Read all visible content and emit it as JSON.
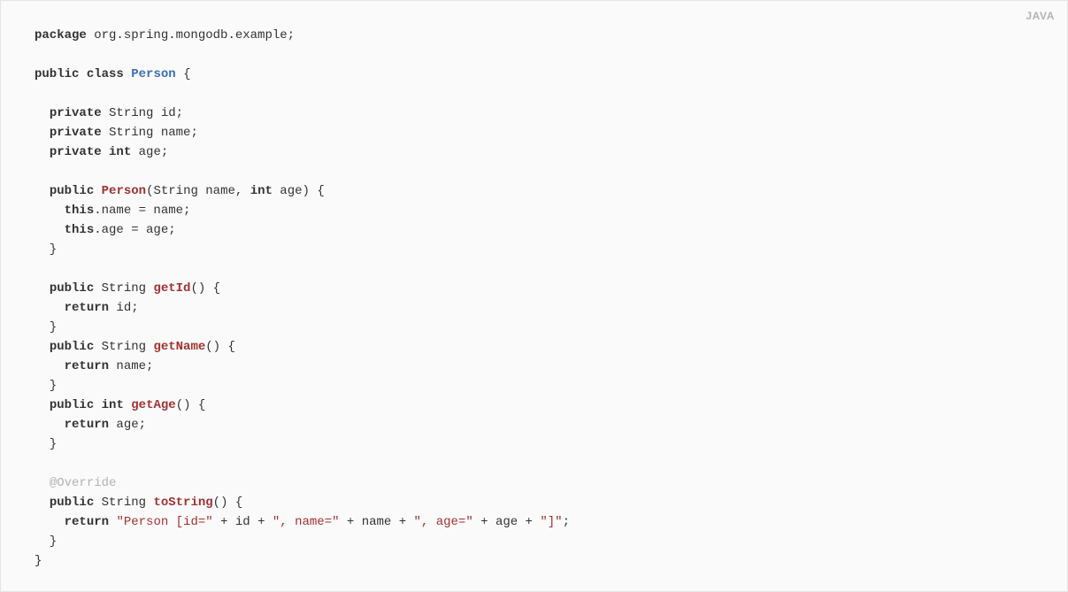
{
  "lang_label": "JAVA",
  "code": {
    "kw_package": "package",
    "pkg_name": " org.spring.mongodb.example;",
    "kw_public1": "public",
    "kw_class": "class",
    "class_name": "Person",
    "brace_open": " {",
    "kw_private1": "private",
    "field_id": " String id;",
    "kw_private2": "private",
    "field_name": " String name;",
    "kw_private3": "private",
    "kw_int1": "int",
    "field_age": " age;",
    "kw_public2": "public",
    "ctor_name": "Person",
    "ctor_sig_open": "(String name, ",
    "kw_int2": "int",
    "ctor_sig_close": " age) {",
    "kw_this1": "this",
    "assign_name": ".name = name;",
    "kw_this2": "this",
    "assign_age": ".age = age;",
    "brace_close1": "  }",
    "kw_public3": "public",
    "ret_str1": " String ",
    "fn_getId": "getId",
    "paren_brace1": "() {",
    "kw_return1": "return",
    "ret_id": " id;",
    "brace_close2": "  }",
    "kw_public4": "public",
    "ret_str2": " String ",
    "fn_getName": "getName",
    "paren_brace2": "() {",
    "kw_return2": "return",
    "ret_name": " name;",
    "brace_close3": "  }",
    "kw_public5": "public",
    "kw_int3": "int",
    "fn_getAge": "getAge",
    "paren_brace3": "() {",
    "kw_return3": "return",
    "ret_age": " age;",
    "brace_close4": "  }",
    "ann_override": "@Override",
    "kw_public6": "public",
    "ret_str3": " String ",
    "fn_toString": "toString",
    "paren_brace4": "() {",
    "kw_return4": "return",
    "str1": "\"Person [id=\"",
    "concat1": " + id + ",
    "str2": "\", name=\"",
    "concat2": " + name + ",
    "str3": "\", age=\"",
    "concat3": " + age + ",
    "str4": "\"]\"",
    "semi": ";",
    "brace_close5": "  }",
    "brace_close6": "}"
  }
}
